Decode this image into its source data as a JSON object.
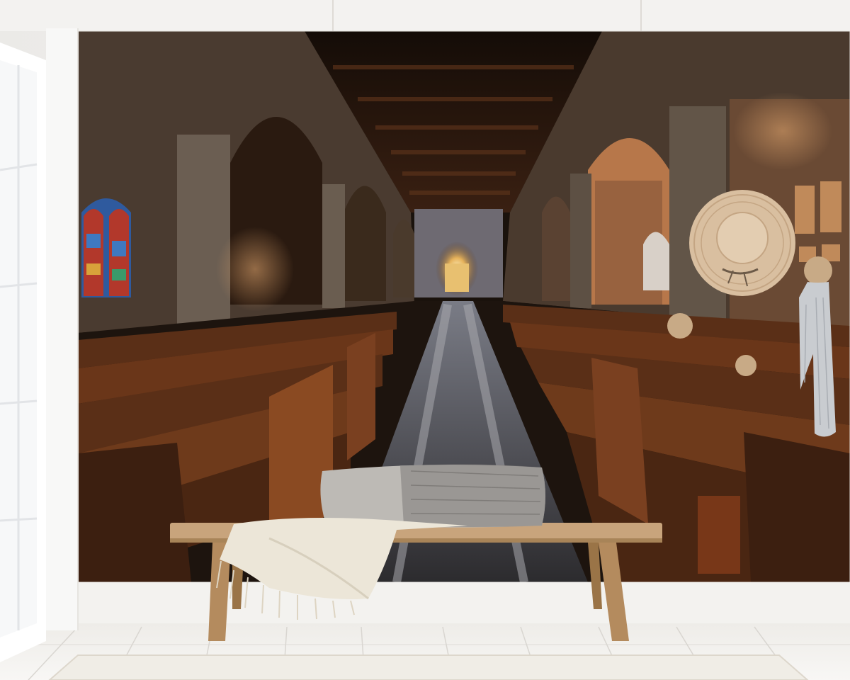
{
  "scene": {
    "subject": "interior-mockup-with-church-nave-wall-mural",
    "colors": {
      "room_wall": "#f4f3f1",
      "window_frame": "#ffffff",
      "floor": "#f6f5f3",
      "floor_seam": "#d9d6d1",
      "mural_dark": "#1a120c",
      "pew_wood": "#5a2f17",
      "pew_highlight": "#8a4a22",
      "stone": "#6b5e52",
      "aisle": "#3b3a3c",
      "bench_wood": "#c8a47c",
      "throw": "#ece6d8",
      "cushion": "#bdbab5",
      "hat": "#d9bfa0",
      "scarf": "#c9ccd0",
      "peg": "#c8aa86",
      "altar_glow": "#e6b25a",
      "stained_glass_red": "#b2382b",
      "stained_glass_blue": "#2f5a9e"
    },
    "icons": [
      "window-icon",
      "stained-glass-window-icon",
      "bench-icon",
      "cushion-icon",
      "throw-blanket-icon",
      "hat-icon",
      "scarf-icon",
      "wall-peg-icon",
      "rug-icon"
    ]
  }
}
